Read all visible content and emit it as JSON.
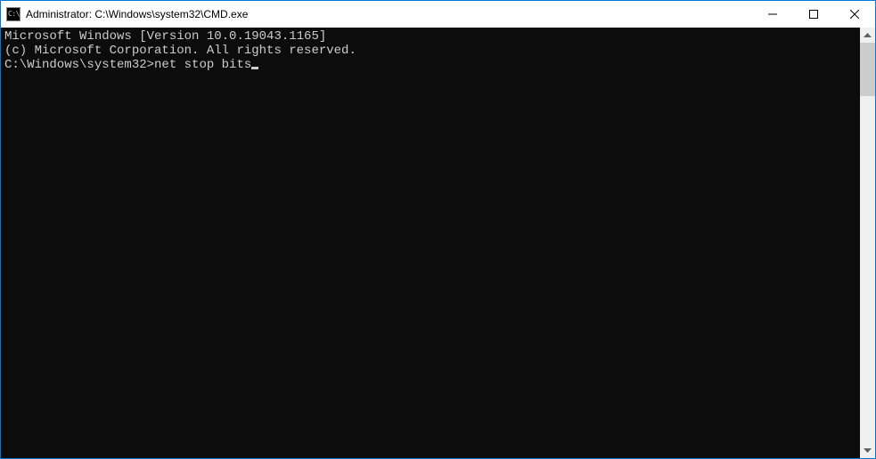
{
  "titlebar": {
    "icon_label": "C:\\",
    "text": "Administrator: C:\\Windows\\system32\\CMD.exe"
  },
  "terminal": {
    "line1": "Microsoft Windows [Version 10.0.19043.1165]",
    "line2": "(c) Microsoft Corporation. All rights reserved.",
    "blank": "",
    "prompt": "C:\\Windows\\system32>",
    "command": "net stop bits"
  }
}
